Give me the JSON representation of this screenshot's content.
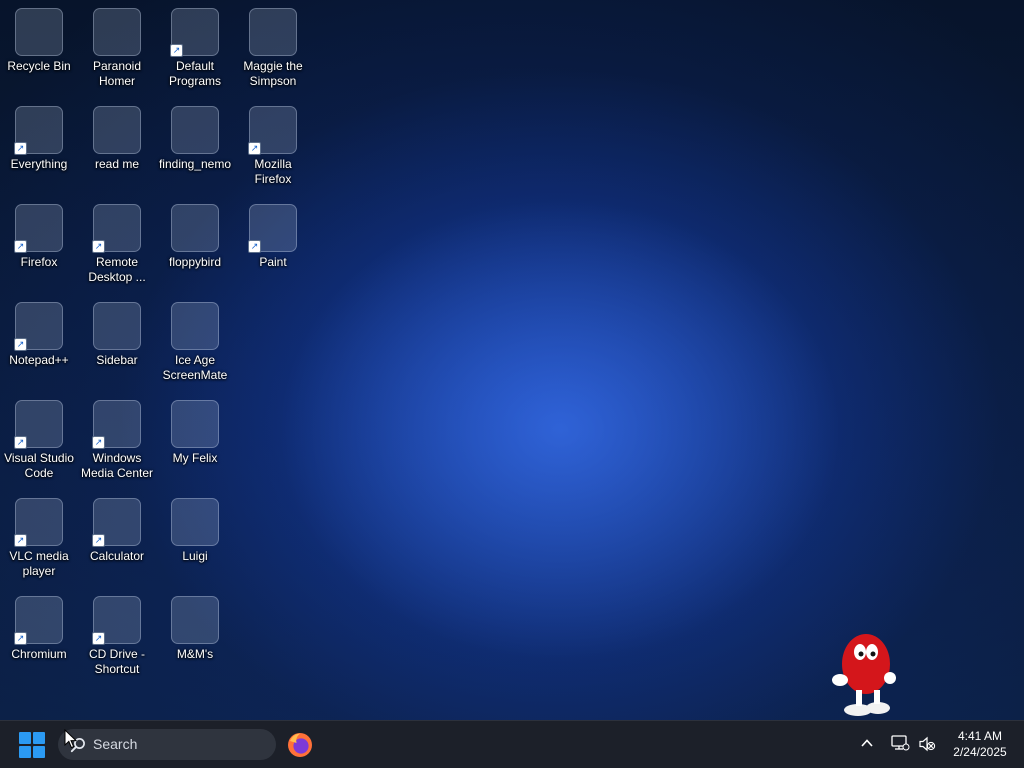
{
  "desktop": {
    "icons": [
      {
        "id": "recycle-bin",
        "label": "Recycle Bin",
        "shortcut": false,
        "icon": "recycle-bin-icon"
      },
      {
        "id": "paranoid-homer",
        "label": "Paranoid\nHomer",
        "shortcut": false,
        "icon": "homer-simpson-icon"
      },
      {
        "id": "default-programs",
        "label": "Default\nPrograms",
        "shortcut": true,
        "icon": "default-programs-icon"
      },
      {
        "id": "maggie-the-simpson",
        "label": "Maggie the\nSimpson",
        "shortcut": false,
        "icon": "maggie-simpson-icon"
      },
      {
        "id": "everything",
        "label": "Everything",
        "shortcut": true,
        "icon": "magnifier-icon"
      },
      {
        "id": "read-me",
        "label": "read me",
        "shortcut": false,
        "icon": "text-document-icon"
      },
      {
        "id": "finding-nemo",
        "label": "finding_nemo",
        "shortcut": false,
        "icon": "clownfish-icon"
      },
      {
        "id": "mozilla-firefox",
        "label": "Mozilla\nFirefox",
        "shortcut": true,
        "icon": "firefox-icon"
      },
      {
        "id": "firefox",
        "label": "Firefox",
        "shortcut": true,
        "icon": "firefox-icon"
      },
      {
        "id": "remote-desktop",
        "label": "Remote\nDesktop ...",
        "shortcut": true,
        "icon": "remote-desktop-icon"
      },
      {
        "id": "floppybird",
        "label": "floppybird",
        "shortcut": false,
        "icon": "html-file-icon"
      },
      {
        "id": "paint",
        "label": "Paint",
        "shortcut": true,
        "icon": "paint-palette-icon"
      },
      {
        "id": "notepad-plus-plus",
        "label": "Notepad++",
        "shortcut": true,
        "icon": "notepad-plus-plus-icon"
      },
      {
        "id": "sidebar",
        "label": "Sidebar",
        "shortcut": false,
        "icon": "blank-document-icon"
      },
      {
        "id": "ice-age-screenmate",
        "label": "Ice Age\nScreenMate",
        "shortcut": false,
        "icon": "ice-age-icon"
      },
      {
        "id": "visual-studio-code",
        "label": "Visual Studio\nCode",
        "shortcut": true,
        "icon": "vscode-icon"
      },
      {
        "id": "windows-media-center",
        "label": "Windows\nMedia Center",
        "shortcut": true,
        "icon": "media-center-icon"
      },
      {
        "id": "my-felix",
        "label": "My Felix",
        "shortcut": false,
        "icon": "felix-cat-icon"
      },
      {
        "id": "vlc-media-player",
        "label": "VLC media\nplayer",
        "shortcut": true,
        "icon": "vlc-cone-icon"
      },
      {
        "id": "calculator",
        "label": "Calculator",
        "shortcut": true,
        "icon": "calculator-icon"
      },
      {
        "id": "luigi",
        "label": "Luigi",
        "shortcut": false,
        "icon": "computer-monitor-icon"
      },
      {
        "id": "chromium",
        "label": "Chromium",
        "shortcut": true,
        "icon": "chromium-icon"
      },
      {
        "id": "cd-drive-shortcut",
        "label": "CD Drive -\nShortcut",
        "shortcut": true,
        "icon": "cd-drive-icon"
      },
      {
        "id": "mms",
        "label": "M&M's",
        "shortcut": false,
        "icon": "red-mm-candy-icon"
      }
    ],
    "mascot": "red-mm-character"
  },
  "taskbar": {
    "start_icon": "windows-logo-icon",
    "search_placeholder": "Search",
    "pinned": [
      {
        "id": "firefox",
        "icon": "firefox-icon"
      }
    ],
    "tray_icons": [
      "chevron-up-icon",
      "network-icon",
      "volume-muted-icon"
    ],
    "time": "4:41 AM",
    "date": "2/24/2025"
  },
  "colors": {
    "taskbar_bg": "#1c2029",
    "search_bg": "#2f343e",
    "accent": "#2b9af3",
    "wallpaper_dark": "#07142b",
    "wallpaper_bloom": "#1e5ae0"
  }
}
